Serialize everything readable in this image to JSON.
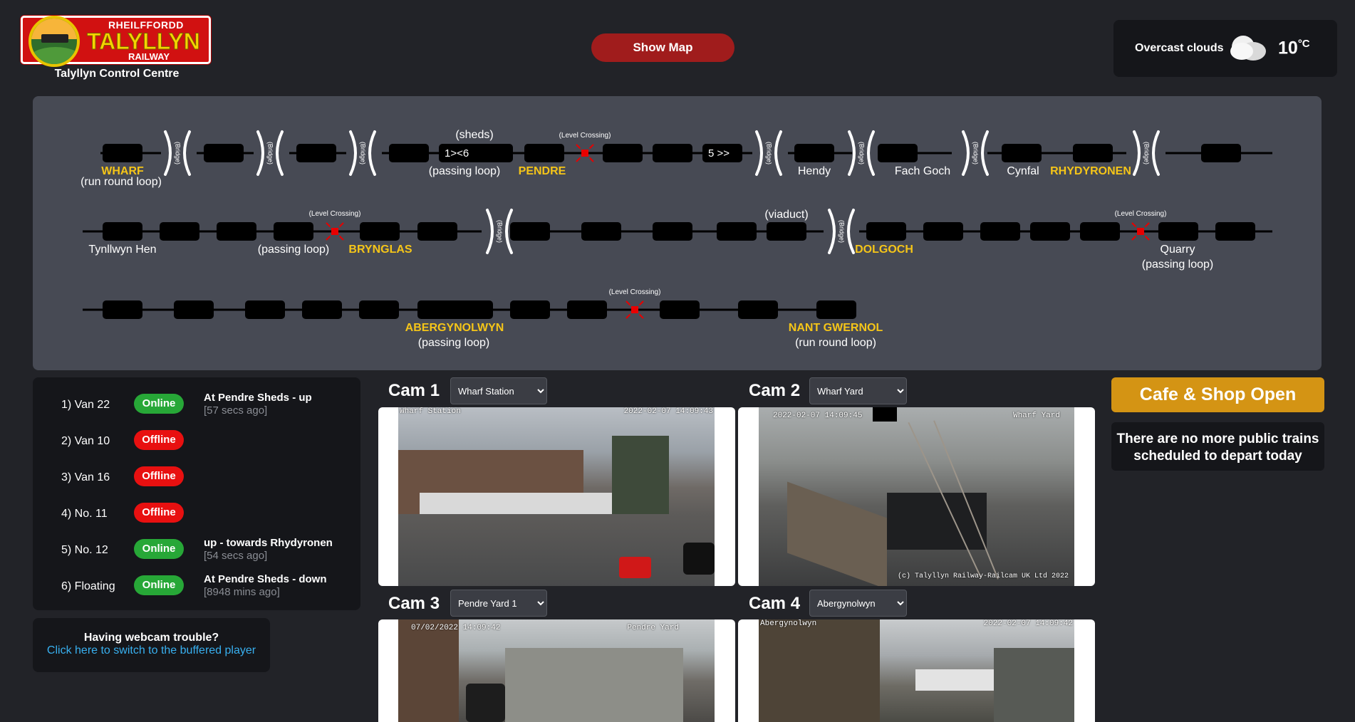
{
  "header": {
    "logo_top": "RHEILFFORDD",
    "logo_main": "TALYLLYN",
    "logo_bottom": "RAILWAY",
    "control_title": "Talyllyn Control Centre",
    "show_map": "Show Map"
  },
  "weather": {
    "description": "Overcast clouds",
    "temp": "10",
    "unit": "°C",
    "icon": "cloud-icon"
  },
  "map": {
    "bridge_label": "(Bridge)",
    "level_crossing": "(Level Crossing)",
    "labels": {
      "wharf": "WHARF",
      "wharf_sub": "(run round loop)",
      "sheds": "(sheds)",
      "seg1": "1><6",
      "seg2": "5  >>",
      "passing_loop_1": "(passing loop)",
      "pendre": "PENDRE",
      "hendy": "Hendy",
      "fach_goch": "Fach Goch",
      "cynfal": "Cynfal",
      "rhydyronen": "RHYDYRONEN",
      "tynllwyn_hen": "Tynllwyn Hen",
      "passing_loop_2": "(passing loop)",
      "brynglas": "BRYNGLAS",
      "viaduct": "(viaduct)",
      "dolgoch": "DOLGOCH",
      "quarry": "Quarry",
      "quarry_sub": "(passing loop)",
      "abergynolwyn": "ABERGYNOLWYN",
      "abergynolwyn_sub": "(passing loop)",
      "nant_gwernol": "NANT GWERNOL",
      "nant_gwernol_sub": "(run round loop)"
    }
  },
  "status": [
    {
      "name": "1) Van 22",
      "state": "Online",
      "location": "At Pendre Sheds - up",
      "ago": "[57 secs ago]"
    },
    {
      "name": "2) Van 10",
      "state": "Offline",
      "location": "",
      "ago": ""
    },
    {
      "name": "3) Van 16",
      "state": "Offline",
      "location": "",
      "ago": ""
    },
    {
      "name": "4) No. 11",
      "state": "Offline",
      "location": "",
      "ago": ""
    },
    {
      "name": "5) No. 12",
      "state": "Online",
      "location": "up - towards Rhydyronen",
      "ago": "[54 secs ago]"
    },
    {
      "name": "6) Floating",
      "state": "Online",
      "location": "At Pendre Sheds - down",
      "ago": "[8948 mins ago]"
    }
  ],
  "trouble": {
    "title": "Having webcam trouble?",
    "link": "Click here to switch to the buffered player"
  },
  "cams": [
    {
      "title": "Cam 1",
      "select": "Wharf Station",
      "stamp_left": "Wharf Station",
      "stamp_right": "2022-02-07 14:09:43"
    },
    {
      "title": "Cam 2",
      "select": "Wharf Yard",
      "stamp_left": "2022-02-07 14:09:45",
      "stamp_right": "Wharf Yard",
      "stamp_bottom": "(c) Talyllyn Railway-Railcam UK Ltd 2022"
    },
    {
      "title": "Cam 3",
      "select": "Pendre Yard 1",
      "stamp_left": "07/02/2022 14:09:42",
      "stamp_right": "Pendre Yard"
    },
    {
      "title": "Cam 4",
      "select": "Abergynolwyn",
      "stamp_left": "Abergynolwyn",
      "stamp_right": "2022-02-07 14:09:42"
    }
  ],
  "right": {
    "cafe": "Cafe & Shop Open",
    "notrains": "There are no more public trains scheduled to depart today"
  },
  "colors": {
    "background": "#222328",
    "panel": "#15161a",
    "map_bg": "#474a54",
    "station_yellow": "#f5c518",
    "online": "#27a737",
    "offline": "#e81010",
    "cafe": "#d49414",
    "show_map": "#a01c1c"
  }
}
